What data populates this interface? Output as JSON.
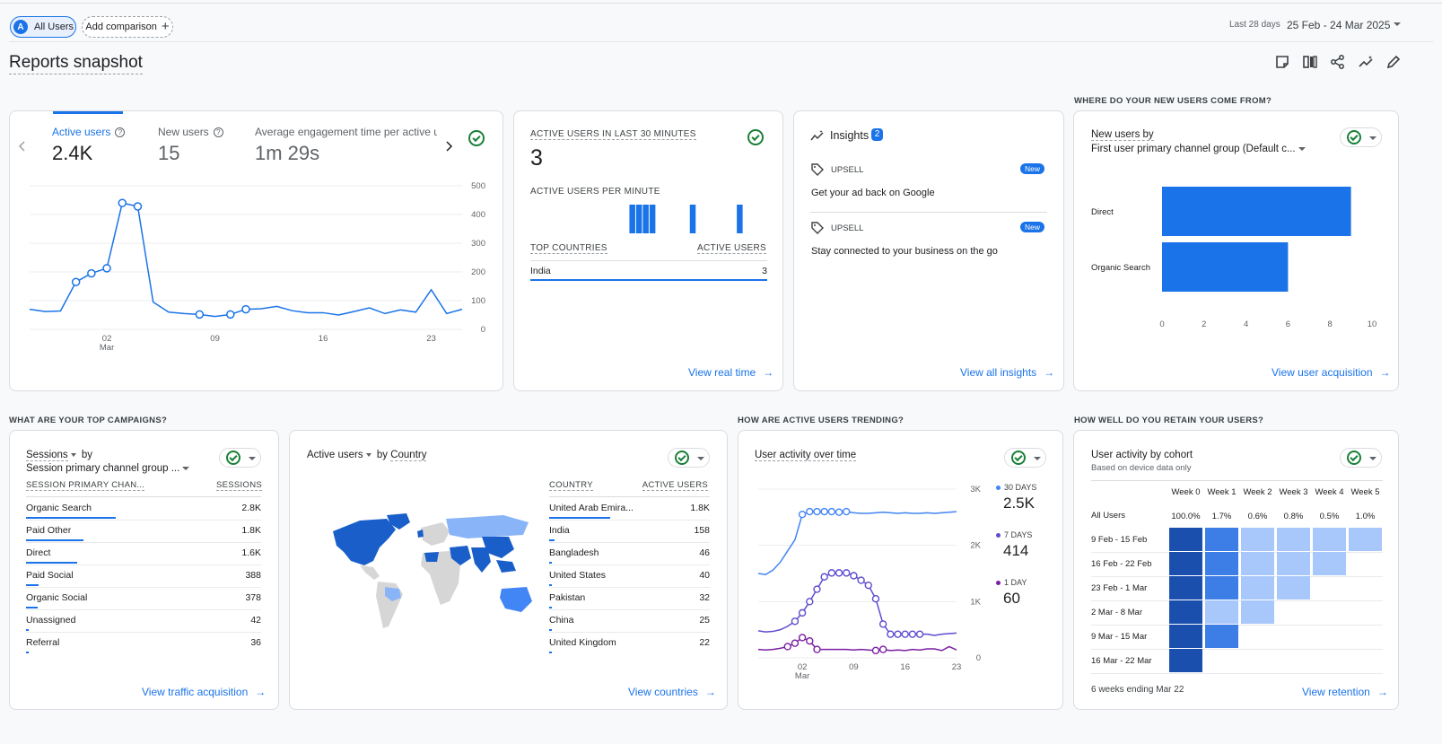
{
  "header": {
    "chip_all_initial": "A",
    "chip_all_label": "All Users",
    "add_comparison_label": "Add comparison",
    "date_range_label": "Last 28 days",
    "date_range_value": "25 Feb - 24 Mar 2025",
    "page_title": "Reports snapshot"
  },
  "sections": {
    "new_users_source": "WHERE DO YOUR NEW USERS COME FROM?",
    "campaigns": "WHAT ARE YOUR TOP CAMPAIGNS?",
    "trending": "HOW ARE ACTIVE USERS TRENDING?",
    "retention": "HOW WELL DO YOU RETAIN YOUR USERS?"
  },
  "overview": {
    "metrics": [
      {
        "label": "Active users",
        "value": "2.4K"
      },
      {
        "label": "New users",
        "value": "15"
      },
      {
        "label": "Average engagement time per active us",
        "value": "1m 29s"
      }
    ],
    "y_ticks": [
      "500",
      "400",
      "300",
      "200",
      "100",
      "0"
    ],
    "x_ticks": [
      "02",
      "09",
      "16",
      "23"
    ],
    "x_month": "Mar",
    "series": [
      70,
      62,
      64,
      165,
      195,
      213,
      440,
      428,
      95,
      60,
      55,
      52,
      45,
      52,
      70,
      72,
      80,
      65,
      58,
      58,
      50,
      62,
      75,
      55,
      68,
      60,
      138,
      55,
      70
    ]
  },
  "realtime": {
    "title": "ACTIVE USERS IN LAST 30 MINUTES",
    "value": "3",
    "per_minute_title": "ACTIVE USERS PER MINUTE",
    "bars_minutes": [
      3,
      4,
      5,
      6,
      12,
      19
    ],
    "col_country": "TOP COUNTRIES",
    "col_users": "ACTIVE USERS",
    "rows": [
      {
        "name": "India",
        "value": "3"
      }
    ],
    "link": "View real time"
  },
  "insights": {
    "title": "Insights",
    "count": "2",
    "items": [
      {
        "tag": "UPSELL",
        "badge": "New",
        "text": "Get your ad back on Google"
      },
      {
        "tag": "UPSELL",
        "badge": "New",
        "text": "Stay connected to your business on the go"
      }
    ],
    "link": "View all insights"
  },
  "acquisition": {
    "title_line1": "New users by",
    "title_line2": "First user primary channel group (Default c...",
    "chart_data": {
      "type": "bar",
      "orientation": "horizontal",
      "categories": [
        "Direct",
        "Organic Search"
      ],
      "values": [
        9,
        6
      ],
      "xlim": [
        0,
        10
      ],
      "x_ticks": [
        "0",
        "2",
        "4",
        "6",
        "8",
        "10"
      ]
    },
    "link": "View user acquisition"
  },
  "campaigns": {
    "title_metric": "Sessions",
    "title_by": "by",
    "title_dim": "Session primary channel group ...",
    "col_dim": "SESSION PRIMARY CHAN...",
    "col_val": "SESSIONS",
    "rows": [
      {
        "name": "Organic Search",
        "value": "2.8K",
        "frac": 1.0
      },
      {
        "name": "Paid Other",
        "value": "1.8K",
        "frac": 0.64
      },
      {
        "name": "Direct",
        "value": "1.6K",
        "frac": 0.57
      },
      {
        "name": "Paid Social",
        "value": "388",
        "frac": 0.14
      },
      {
        "name": "Organic Social",
        "value": "378",
        "frac": 0.13
      },
      {
        "name": "Unassigned",
        "value": "42",
        "frac": 0.02
      },
      {
        "name": "Referral",
        "value": "36",
        "frac": 0.02
      }
    ],
    "link": "View traffic acquisition"
  },
  "countries": {
    "title_metric": "Active users",
    "title_by": "by",
    "title_dim": "Country",
    "col_dim": "COUNTRY",
    "col_val": "ACTIVE USERS",
    "rows": [
      {
        "name": "United Arab Emira...",
        "value": "1.8K",
        "frac": 1.0
      },
      {
        "name": "India",
        "value": "158",
        "frac": 0.09
      },
      {
        "name": "Bangladesh",
        "value": "46",
        "frac": 0.03
      },
      {
        "name": "United States",
        "value": "40",
        "frac": 0.02
      },
      {
        "name": "Pakistan",
        "value": "32",
        "frac": 0.02
      },
      {
        "name": "China",
        "value": "25",
        "frac": 0.01
      },
      {
        "name": "United Kingdom",
        "value": "22",
        "frac": 0.01
      }
    ],
    "link": "View countries"
  },
  "trend": {
    "title": "User activity over time",
    "y_ticks": [
      "3K",
      "2K",
      "1K",
      "0"
    ],
    "x_ticks": [
      "02",
      "09",
      "16",
      "23"
    ],
    "x_month": "Mar",
    "legend": [
      {
        "label": "30 DAYS",
        "value": "2.5K",
        "color": "#4285f4"
      },
      {
        "label": "7 DAYS",
        "value": "414",
        "color": "#5c4ccf"
      },
      {
        "label": "1 DAY",
        "value": "60",
        "color": "#7b1fa2"
      }
    ],
    "chart_data": {
      "type": "line",
      "ylim": [
        0,
        3000
      ],
      "series": [
        {
          "name": "30 DAYS",
          "values": [
            1500,
            1480,
            1560,
            1700,
            1900,
            2100,
            2550,
            2600,
            2600,
            2600,
            2600,
            2590,
            2600,
            2580,
            2570,
            2570,
            2580,
            2590,
            2580,
            2570,
            2580,
            2570,
            2570,
            2580,
            2570,
            2580,
            2590,
            2600
          ]
        },
        {
          "name": "7 DAYS",
          "values": [
            480,
            460,
            470,
            500,
            560,
            650,
            800,
            1000,
            1220,
            1440,
            1510,
            1510,
            1510,
            1460,
            1380,
            1290,
            1050,
            600,
            420,
            420,
            420,
            420,
            420,
            420,
            400,
            420,
            430,
            440
          ]
        },
        {
          "name": "1 DAY",
          "values": [
            150,
            140,
            150,
            170,
            200,
            260,
            360,
            300,
            150,
            150,
            150,
            150,
            150,
            140,
            150,
            140,
            130,
            150,
            130,
            140,
            130,
            150,
            140,
            160,
            160,
            130,
            200,
            140
          ]
        }
      ]
    }
  },
  "retention": {
    "title": "User activity by cohort",
    "subtitle": "Based on device data only",
    "weeks": [
      "Week 0",
      "Week 1",
      "Week 2",
      "Week 3",
      "Week 4",
      "Week 5"
    ],
    "all_users_label": "All Users",
    "all_users_values": [
      "100.0%",
      "1.7%",
      "0.6%",
      "0.8%",
      "0.5%",
      "1.0%"
    ],
    "cohorts": [
      {
        "label": "9 Feb - 15 Feb",
        "cells": [
          1.0,
          0.8,
          0.3,
          0.3,
          0.3,
          0.3
        ]
      },
      {
        "label": "16 Feb - 22 Feb",
        "cells": [
          1.0,
          0.6,
          0.3,
          0.3,
          0.3
        ]
      },
      {
        "label": "23 Feb - 1 Mar",
        "cells": [
          1.0,
          0.6,
          0.3,
          0.3
        ]
      },
      {
        "label": "2 Mar - 8 Mar",
        "cells": [
          1.0,
          0.3,
          0.3
        ]
      },
      {
        "label": "9 Mar - 15 Mar",
        "cells": [
          1.0,
          0.6
        ]
      },
      {
        "label": "16 Mar - 22 Mar",
        "cells": [
          1.0
        ]
      }
    ],
    "footer": "6 weeks ending Mar 22",
    "link": "View retention"
  }
}
